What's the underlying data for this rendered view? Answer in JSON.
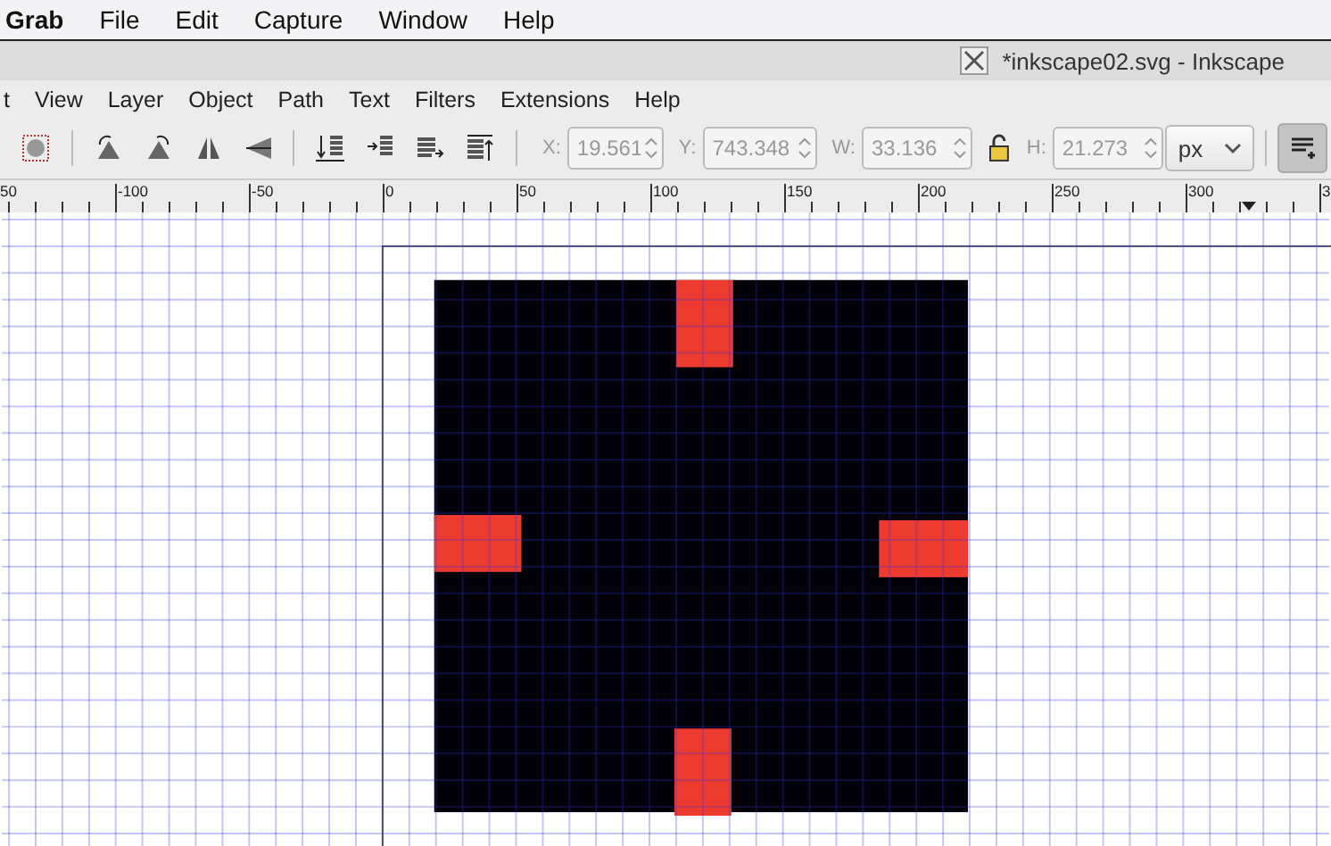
{
  "system_menu_bar": {
    "app_name": "Grab",
    "items": [
      "File",
      "Edit",
      "Capture",
      "Window",
      "Help"
    ]
  },
  "window": {
    "title": "*inkscape02.svg - Inkscape"
  },
  "menu_bar": {
    "items": [
      "t",
      "View",
      "Layer",
      "Object",
      "Path",
      "Text",
      "Filters",
      "Extensions",
      "Help"
    ]
  },
  "toolbar": {
    "fields": [
      {
        "label": "X:",
        "value": "19.561"
      },
      {
        "label": "Y:",
        "value": "743.348"
      },
      {
        "label": "W:",
        "value": "33.136"
      },
      {
        "label": "H:",
        "value": "21.273"
      }
    ],
    "lock": {
      "on": false
    },
    "unit": "px",
    "toggle_button": {
      "on": true
    }
  },
  "ruler": {
    "labels": [
      "50",
      "-100",
      "-50",
      "0",
      "50",
      "100",
      "150",
      "200",
      "250",
      "300",
      "3"
    ]
  }
}
